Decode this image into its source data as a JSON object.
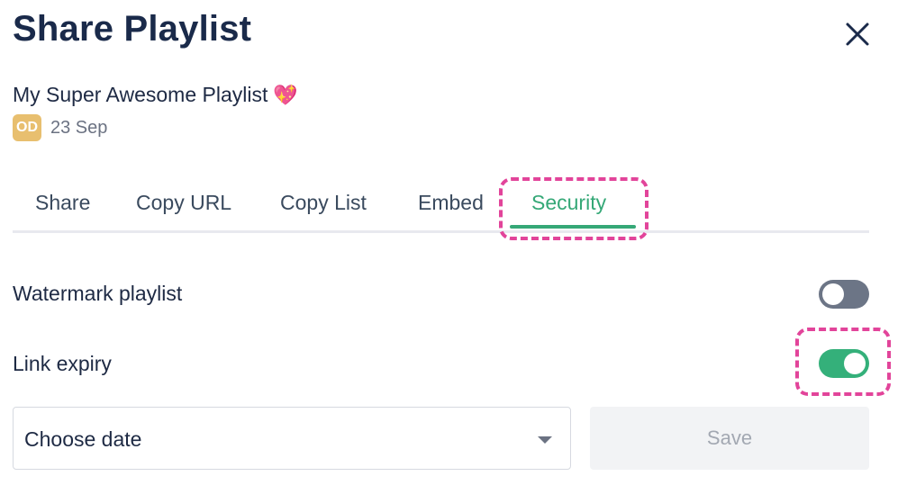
{
  "dialog": {
    "title": "Share Playlist",
    "close_icon": "close-icon"
  },
  "playlist": {
    "name": "My Super Awesome Playlist",
    "emoji": "💖",
    "owner_initials": "OD",
    "date": "23 Sep"
  },
  "tabs": [
    {
      "label": "Share",
      "active": false
    },
    {
      "label": "Copy URL",
      "active": false
    },
    {
      "label": "Copy List",
      "active": false
    },
    {
      "label": "Embed",
      "active": false
    },
    {
      "label": "Security",
      "active": true
    }
  ],
  "settings": {
    "watermark": {
      "label": "Watermark playlist",
      "enabled": false
    },
    "link_expiry": {
      "label": "Link expiry",
      "enabled": true
    }
  },
  "expiry_date": {
    "value": "Choose date"
  },
  "save_label": "Save",
  "colors": {
    "accent": "#35a877",
    "highlight": "#e2449a",
    "toggle_on": "#34b07a",
    "toggle_off": "#6c7586",
    "avatar": "#e8bf6f"
  }
}
